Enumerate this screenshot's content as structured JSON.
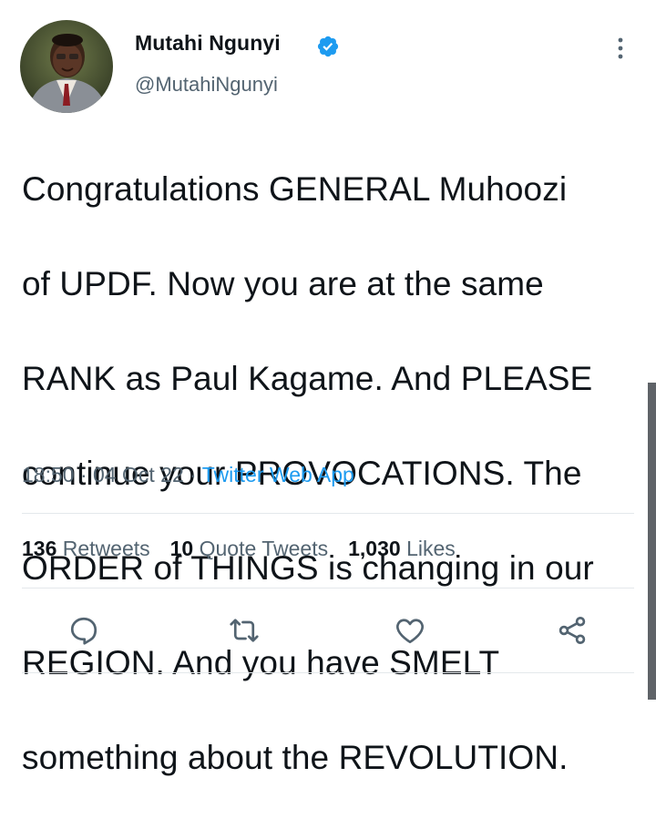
{
  "author": {
    "display_name": "Mutahi Ngunyi",
    "handle": "@MutahiNgunyi",
    "verified": true
  },
  "tweet": {
    "text_lines": [
      "Congratulations GENERAL Muhoozi",
      "of UPDF. Now you are at the same",
      "RANK as Paul Kagame. And PLEASE",
      "continue your PROVOCATIONS. The",
      "ORDER of THINGS is changing in our",
      "REGION. And you have SMELT",
      "something about the REVOLUTION."
    ],
    "time": "18:50",
    "separator": " · ",
    "date": "04 Oct 22",
    "source": "Twitter Web App"
  },
  "stats": {
    "retweets_count": "136",
    "retweets_label": "Retweets",
    "quotes_count": "10",
    "quotes_label": "Quote Tweets",
    "likes_count": "1,030",
    "likes_label": "Likes"
  },
  "actions": {
    "reply_icon": "reply-icon",
    "retweet_icon": "retweet-icon",
    "like_icon": "heart-icon",
    "share_icon": "share-icon"
  },
  "colors": {
    "text": "#0f1419",
    "secondary": "#536471",
    "accent": "#1d9bf0",
    "divider": "#e4e8eb"
  }
}
